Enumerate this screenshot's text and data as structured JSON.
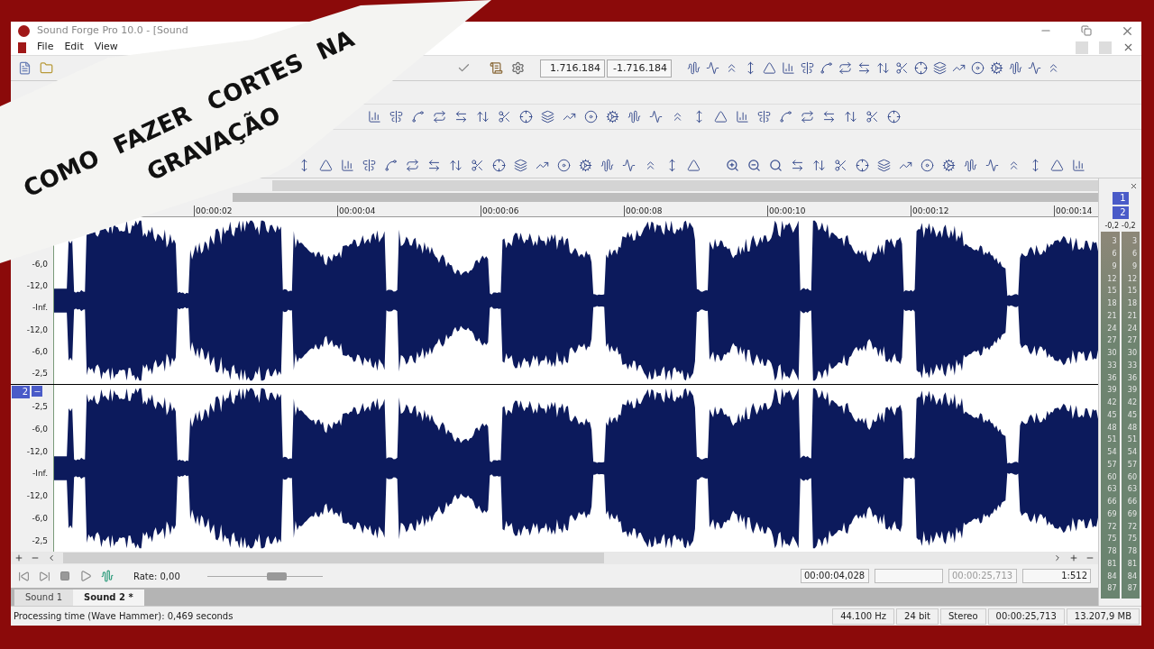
{
  "banner": {
    "words": [
      "COMO",
      "FAZER",
      "CORTES",
      "NA",
      "GRAVAÇÃO"
    ]
  },
  "window": {
    "title": "Sound Forge Pro 10.0 - [Sound"
  },
  "menu": [
    "File",
    "Edit",
    "View"
  ],
  "toolbar": {
    "fields": [
      "1.716.184",
      "-1.716.184"
    ]
  },
  "ruler": {
    "labels": [
      "00:00:02",
      "00:00:04",
      "00:00:06",
      "00:00:08",
      "00:00:10",
      "00:00:12",
      "00:00:14"
    ]
  },
  "channels": [
    {
      "scale": [
        "-6,0",
        "-12,0",
        "-Inf.",
        "-12,0",
        "-6,0",
        "-2,5"
      ]
    },
    {
      "badge": "2",
      "scale": [
        "-2,5",
        "-6,0",
        "-12,0",
        "-Inf.",
        "-12,0",
        "-6,0",
        "-2,5"
      ]
    }
  ],
  "transport": {
    "rate": "Rate: 0,00",
    "level": 0.22
  },
  "position_fields": [
    {
      "kind": "time",
      "value": "00:00:04,028"
    },
    {
      "kind": "blank"
    },
    {
      "kind": "dim",
      "value": "00:00:25,713"
    },
    {
      "kind": "zoom",
      "value": "1:512"
    }
  ],
  "tabs": [
    {
      "label": "Sound 1",
      "selected": false
    },
    {
      "label": "Sound 2 *",
      "selected": true
    }
  ],
  "meter": {
    "channels": [
      {
        "button": "1",
        "peak": "-0,2",
        "scale": [
          "3",
          "6",
          "9",
          "12",
          "15",
          "18",
          "21",
          "24",
          "27",
          "30",
          "33",
          "36",
          "39",
          "42",
          "45",
          "48",
          "51",
          "54",
          "57",
          "60",
          "63",
          "66",
          "69",
          "72",
          "75",
          "78",
          "81",
          "84",
          "87"
        ]
      },
      {
        "button": "2",
        "peak": "-0,2",
        "scale": [
          "3",
          "6",
          "9",
          "12",
          "15",
          "18",
          "21",
          "24",
          "27",
          "30",
          "33",
          "36",
          "39",
          "42",
          "45",
          "48",
          "51",
          "54",
          "57",
          "60",
          "63",
          "66",
          "69",
          "72",
          "75",
          "78",
          "81",
          "84",
          "87"
        ]
      }
    ]
  },
  "status_bar": {
    "message": "Processing time (Wave Hammer): 0,469 seconds",
    "fields": [
      "44.100 Hz",
      "24 bit",
      "Stereo",
      "00:00:25,713",
      "13.207,9 MB"
    ]
  }
}
